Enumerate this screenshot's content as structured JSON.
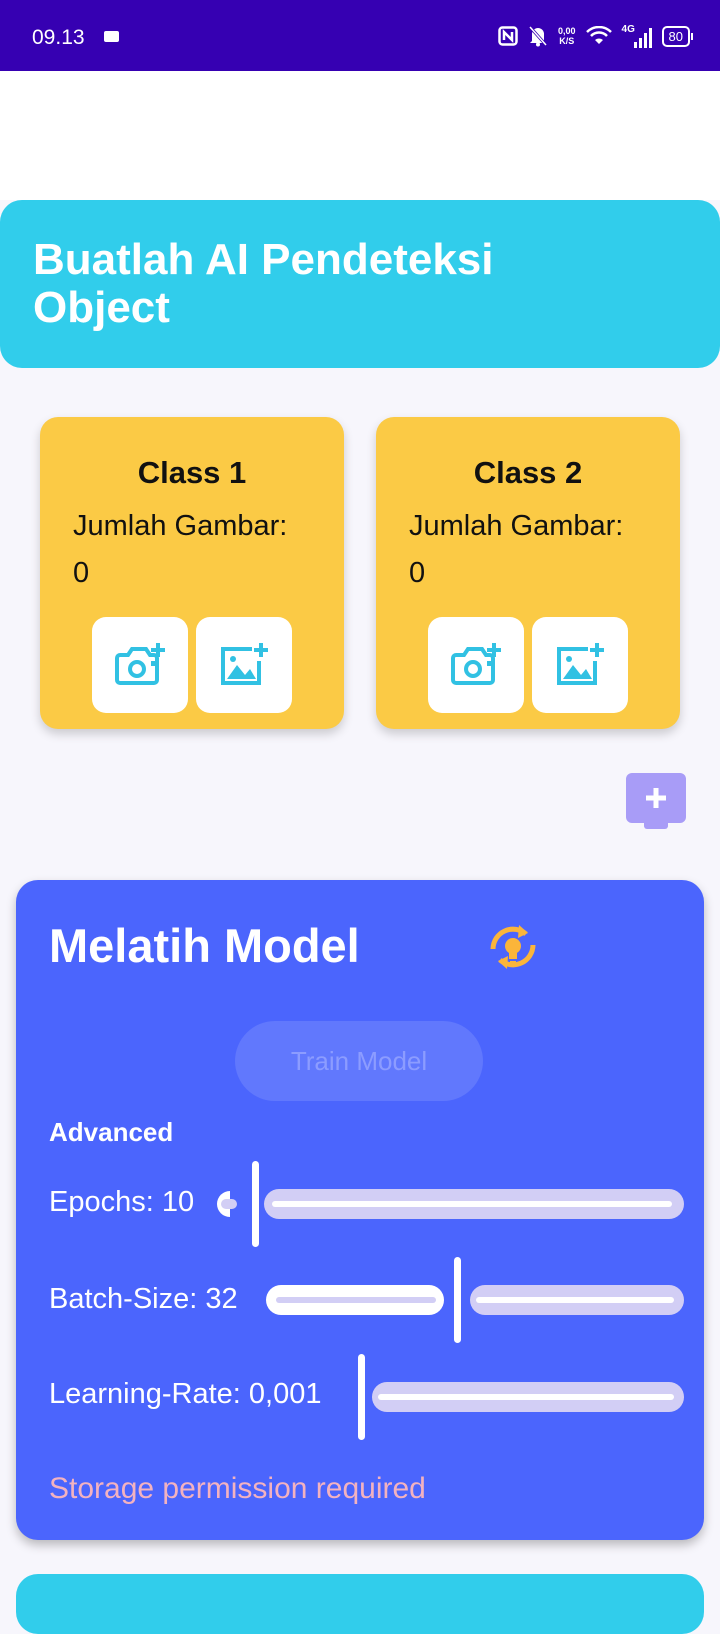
{
  "status_bar": {
    "time": "09.13",
    "net_speed_value": "0,00",
    "net_speed_unit": "K/S",
    "network_type": "4G",
    "battery": "80"
  },
  "header": {
    "title": "Buatlah AI Pendeteksi Object"
  },
  "classes": [
    {
      "title": "Class 1",
      "count_label": "Jumlah Gambar: 0"
    },
    {
      "title": "Class 2",
      "count_label": "Jumlah Gambar: 0"
    }
  ],
  "train": {
    "title": "Melatih Model",
    "button_label": "Train Model",
    "advanced_label": "Advanced",
    "epochs": {
      "label": "Epochs: 10",
      "value": 10,
      "level": 0.0
    },
    "batch_size": {
      "label": "Batch-Size: 32",
      "value": 32,
      "level": 0.48
    },
    "learning_rate": {
      "label": "Learning-Rate: 0,001",
      "value": 0.001,
      "level": 0.0
    },
    "permission_note": "Storage permission required"
  },
  "colors": {
    "status_bar": "#3600b2",
    "header": "#31cdeb",
    "class_card": "#fbca45",
    "train_card": "#4b65fd",
    "icon_accent": "#31c1e3",
    "train_icon": "#fbb53a",
    "add_button": "#a89cf7"
  },
  "icons": [
    "camera-add-icon",
    "gallery-add-icon",
    "add-icon",
    "sync-lightbulb-icon",
    "nfc-icon",
    "bell-off-icon",
    "wifi-icon",
    "signal-icon",
    "battery-icon"
  ]
}
